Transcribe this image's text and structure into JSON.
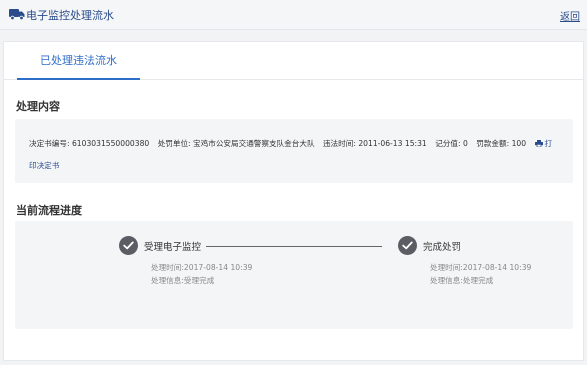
{
  "header": {
    "title": "电子监控处理流水",
    "back_label": "返回",
    "icon": "truck-icon"
  },
  "tabs": [
    {
      "label": "已处理违法流水",
      "active": true
    }
  ],
  "content_section": {
    "title": "处理内容",
    "fields": [
      {
        "label": "决定书编号:",
        "value": "6103031550000380"
      },
      {
        "label": "处罚单位:",
        "value": "宝鸡市公安局交通警察支队金台大队"
      },
      {
        "label": "违法时间:",
        "value": "2011-06-13 15:31"
      },
      {
        "label": "记分值:",
        "value": "0"
      },
      {
        "label": "罚款金额:",
        "value": "100"
      }
    ],
    "print_label_part1": "打",
    "print_label_part2": "印决定书",
    "print_icon": "printer-icon"
  },
  "progress_section": {
    "title": "当前流程进度",
    "steps": [
      {
        "label": "受理电子监控",
        "time": "处理时间:2017-08-14 10:39",
        "info": "处理信息:受理完成",
        "status": "done",
        "icon": "check-icon"
      },
      {
        "label": "完成处罚",
        "time": "处理时间:2017-08-14 10:39",
        "info": "处理信息:处理完成",
        "status": "done",
        "icon": "check-icon"
      }
    ]
  },
  "colors": {
    "accent": "#2f6ec7",
    "link": "#2b4c8c",
    "step_circle": "#5a5d63",
    "panel_bg": "#f4f5f7",
    "page_bg": "#f2f3f5"
  }
}
